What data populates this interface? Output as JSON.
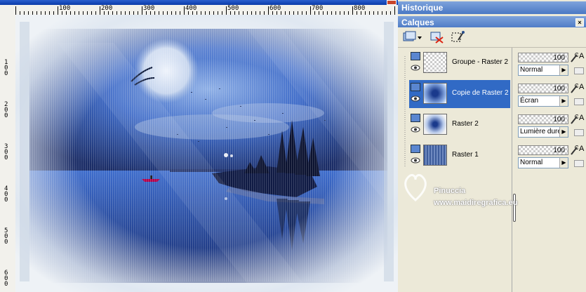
{
  "panels": {
    "history_title": "Historique",
    "layers_title": "Calques"
  },
  "toolbar": {
    "icons": [
      "new-layer-icon",
      "delete-layer-icon",
      "mask-icon"
    ]
  },
  "ruler": {
    "top_labels": [
      "100",
      "200",
      "300",
      "400",
      "500",
      "600",
      "700",
      "800"
    ],
    "left_labels": [
      "100",
      "200",
      "300",
      "400",
      "500",
      "600"
    ]
  },
  "layers": [
    {
      "name": "Groupe - Raster 2",
      "opacity": "100",
      "blend": "Normal",
      "selected": false
    },
    {
      "name": "Copie de Raster 2",
      "opacity": "100",
      "blend": "Écran",
      "selected": true
    },
    {
      "name": "Raster 2",
      "opacity": "100",
      "blend": "Lumière dure",
      "selected": false
    },
    {
      "name": "Raster 1",
      "opacity": "100",
      "blend": "Normal",
      "selected": false
    }
  ],
  "props_letter": "A",
  "watermark": {
    "line1": "Pinuccia",
    "line2": "www.maidiregrafica.eu"
  },
  "colors": {
    "selected": "#316ac5",
    "panel_header": "#4a78c4",
    "panel_bg": "#ece9d8"
  }
}
